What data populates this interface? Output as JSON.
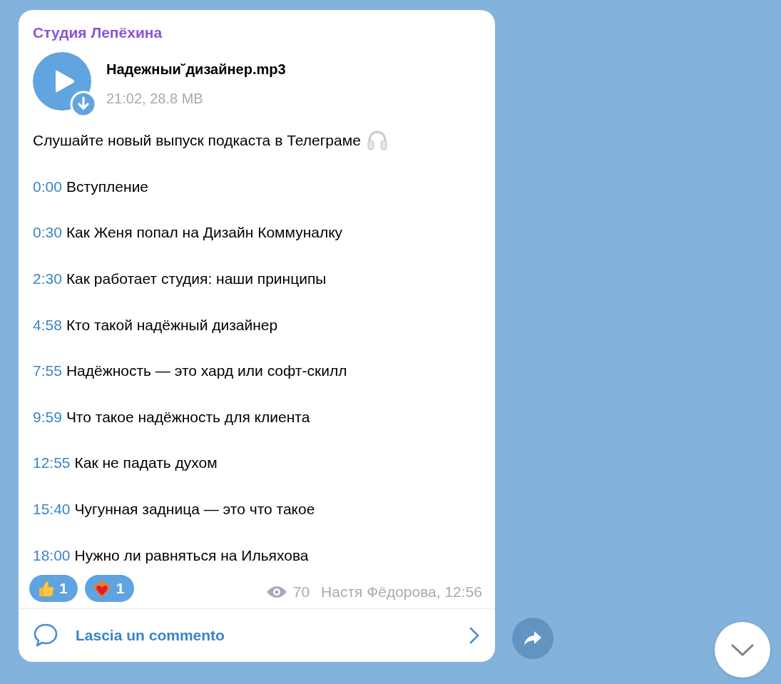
{
  "channel": {
    "name": "Студия Лепёхина"
  },
  "audio": {
    "filename": "Надежныи˘дизайнер.mp3",
    "meta": "21:02, 28.8 MB"
  },
  "caption": "Слушайте новый выпуск подкаста в Телеграме",
  "chapters": [
    {
      "time": "0:00",
      "title": "Вступление"
    },
    {
      "time": "0:30",
      "title": "Как Женя попал на Дизайн Коммуналку"
    },
    {
      "time": "2:30",
      "title": "Как работает студия: наши принципы"
    },
    {
      "time": "4:58",
      "title": "Кто такой надёжный дизайнер"
    },
    {
      "time": "7:55",
      "title": "Надёжность — это хард или софт-скилл"
    },
    {
      "time": "9:59",
      "title": "Что такое надёжность для клиента"
    },
    {
      "time": "12:55",
      "title": "Как не падать духом"
    },
    {
      "time": "15:40",
      "title": "Чугунная задница — это что такое"
    },
    {
      "time": "18:00",
      "title": "Нужно ли равняться на Ильяхова"
    }
  ],
  "reactions": [
    {
      "kind": "thumbs-up",
      "count": "1",
      "selected": true
    },
    {
      "kind": "fire-heart",
      "count": "1",
      "selected": true
    }
  ],
  "views": "70",
  "signature": "Настя Фёдорова, 12:56",
  "comment_button": {
    "label": "Lascia un commento"
  }
}
